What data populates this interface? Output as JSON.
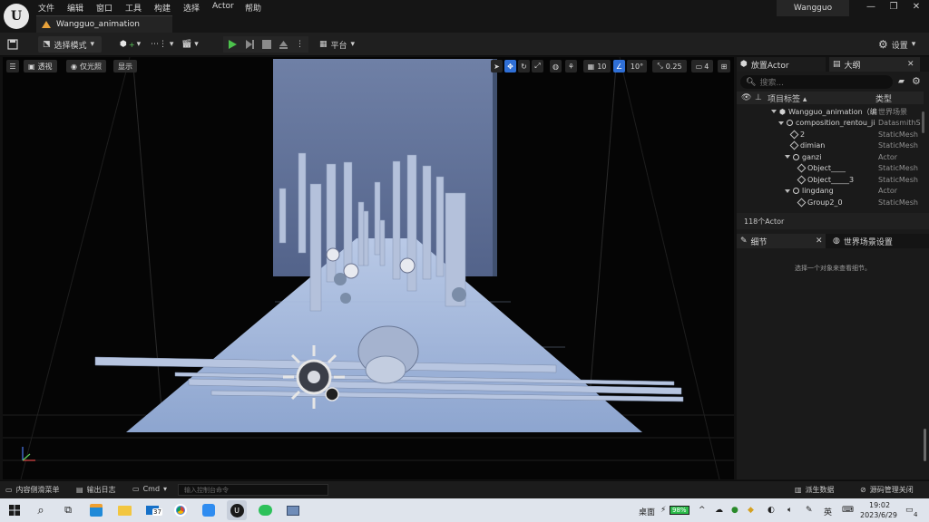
{
  "titlebar": {
    "menu": [
      "文件",
      "编辑",
      "窗口",
      "工具",
      "构建",
      "选择",
      "Actor",
      "帮助"
    ],
    "doc_tab": "Wangguo_animation",
    "project": "Wangguo",
    "window_controls": [
      "—",
      "❐",
      "✕"
    ]
  },
  "toolbar": {
    "mode": "选择模式",
    "platform": "平台",
    "settings": "设置"
  },
  "viewport": {
    "left_chips": [
      "透视",
      "仅光照",
      "显示"
    ],
    "grid_snap": "10",
    "rotate_snap": "10°",
    "scale_snap": "0.25",
    "camera_speed": "4"
  },
  "outliner": {
    "tab_place": "放置Actor",
    "tab_outliner": "大纲",
    "search_placeholder": "搜索...",
    "col_label": "项目标签 ▴",
    "col_type": "类型",
    "rows": [
      {
        "name": "Wangguo_animation（编",
        "type": "世界场景",
        "indent": 0,
        "icon": "world"
      },
      {
        "name": "composition_rentou_ji",
        "type": "DatasmithS",
        "indent": 1,
        "icon": "actor"
      },
      {
        "name": "2",
        "type": "StaticMesh",
        "indent": 2,
        "icon": "mesh"
      },
      {
        "name": "dimian",
        "type": "StaticMesh",
        "indent": 2,
        "icon": "mesh"
      },
      {
        "name": "ganzi",
        "type": "Actor",
        "indent": 2,
        "icon": "actor"
      },
      {
        "name": "Object____",
        "type": "StaticMesh",
        "indent": 3,
        "icon": "mesh"
      },
      {
        "name": "Object_____3",
        "type": "StaticMesh",
        "indent": 3,
        "icon": "mesh"
      },
      {
        "name": "lingdang",
        "type": "Actor",
        "indent": 2,
        "icon": "actor"
      },
      {
        "name": "Group2_0",
        "type": "StaticMesh",
        "indent": 3,
        "icon": "mesh"
      }
    ],
    "count": "118个Actor"
  },
  "details": {
    "tab_details": "细节",
    "tab_world": "世界场景设置",
    "empty_hint": "选择一个对象来查看细节。"
  },
  "bottombar": {
    "content_drawer": "内容侧滑菜单",
    "output_log": "输出日志",
    "cmd": "Cmd",
    "console_placeholder": "输入控制台命令",
    "derived_data": "派生数据",
    "source_control": "源码管理关闭"
  },
  "taskbar": {
    "mail_badge": "37",
    "tray_label": "桌面",
    "battery": "98%",
    "ime": "英",
    "time": "19:02",
    "date": "2023/6/29",
    "notifications": "4"
  }
}
